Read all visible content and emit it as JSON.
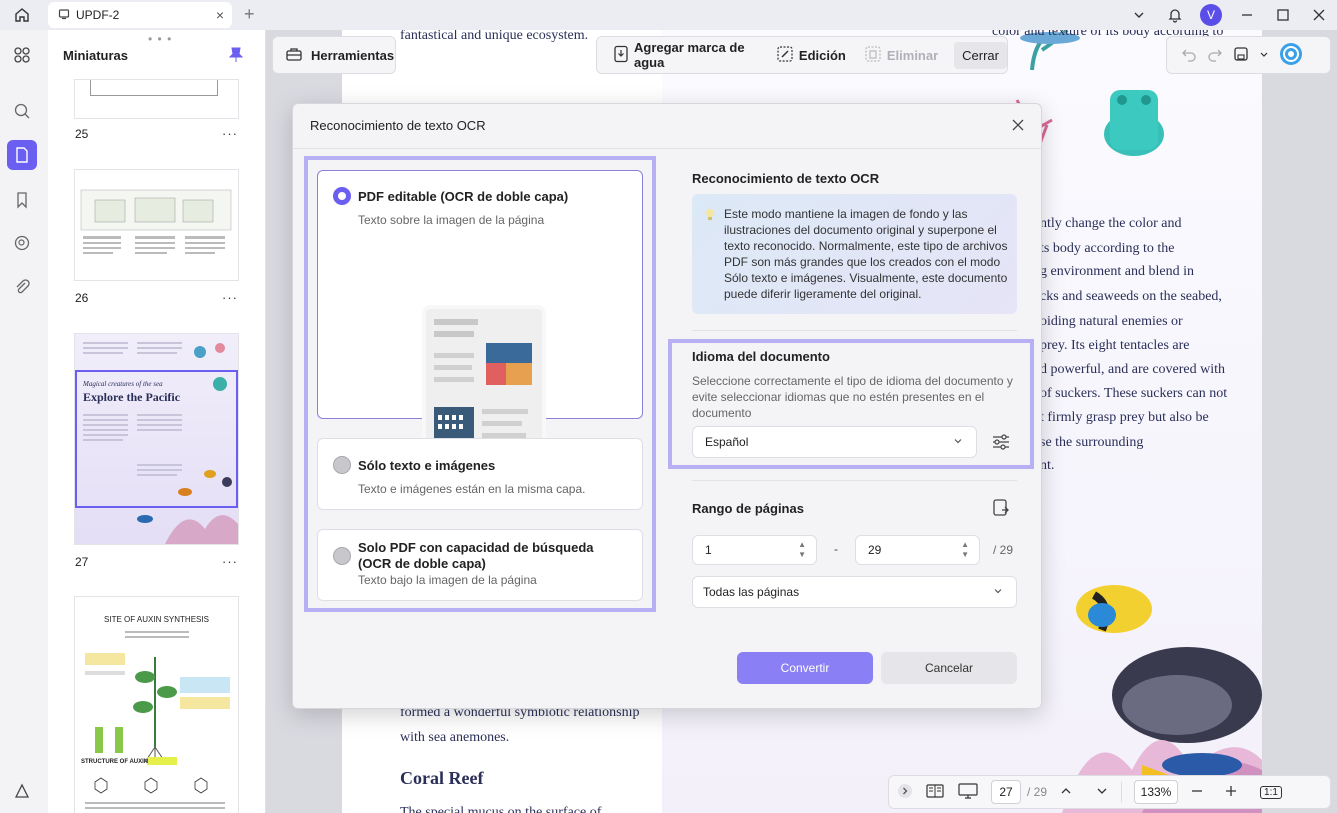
{
  "titlebar": {
    "tab_title": "UPDF-2",
    "avatar_initial": "V"
  },
  "thumbs": {
    "header": "Miniaturas",
    "pages": [
      "25",
      "26",
      "27"
    ],
    "more": "···",
    "thumb_texts": {
      "p27_subtitle": "Magical creatures of the sea",
      "p27_title": "Explore the Pacific",
      "p28_title": "SITE OF AUXIN SYNTHESIS",
      "p28_label": "STRUCTURE OF AUXIN"
    }
  },
  "toolbar": {
    "tools_label": "Herramientas",
    "watermark_label": "Agregar marca de agua",
    "edit_label": "Edición",
    "delete_label": "Eliminar",
    "close_label": "Cerrar"
  },
  "document": {
    "top_line": "fantastical and unique ecosystem.",
    "top_line_right": "color and texture of its body according to",
    "right_lines": [
      "ntly change the color and",
      "ts body according to the",
      "g environment and blend in",
      "cks and seaweeds on the seabed,",
      "oiding natural enemies or",
      "prey. Its eight tentacles are",
      "d powerful, and are covered with",
      "of suckers. These suckers can not",
      "t firmly grasp prey but also be",
      "se the surrounding",
      "nt."
    ],
    "bottom_lines": [
      "formed a wonderful symbiotic relationship",
      "with sea anemones."
    ],
    "heading": "Coral Reef",
    "last_line": "The special mucus on the surface of"
  },
  "bottombar": {
    "current_page": "27",
    "total_pages": "/ 29",
    "zoom": "133%",
    "fit_label": "1:1"
  },
  "dialog": {
    "title": "Reconocimiento de texto OCR",
    "options": [
      {
        "title": "PDF editable (OCR de doble capa)",
        "subtitle": "Texto sobre la imagen de la página",
        "selected": true
      },
      {
        "title": "Sólo texto e imágenes",
        "subtitle": "Texto e imágenes están en la misma capa.",
        "selected": false
      },
      {
        "title": "Solo PDF con capacidad de búsqueda (OCR de doble capa)",
        "subtitle": "Texto bajo la imagen de la página",
        "selected": false
      }
    ],
    "info_title": "Reconocimiento de texto OCR",
    "info_text": "Este modo mantiene la imagen de fondo y las ilustraciones del documento original y superpone el texto reconocido. Normalmente, este tipo de archivos PDF son más grandes que los creados con el modo Sólo texto e imágenes. Visualmente, este documento puede diferir ligeramente del original.",
    "lang_title": "Idioma del documento",
    "lang_desc": "Seleccione correctamente el tipo de idioma del documento y evite seleccionar idiomas que no estén presentes en el documento",
    "lang_value": "Español",
    "range_title": "Rango de páginas",
    "range_from": "1",
    "range_to": "29",
    "range_dash": "-",
    "range_total": "/ 29",
    "range_mode": "Todas las páginas",
    "convert_label": "Convertir",
    "cancel_label": "Cancelar"
  },
  "colors": {
    "accent": "#6b5ff2",
    "highlight": "#b8b0f4",
    "primary_button": "#8a7ff5"
  }
}
